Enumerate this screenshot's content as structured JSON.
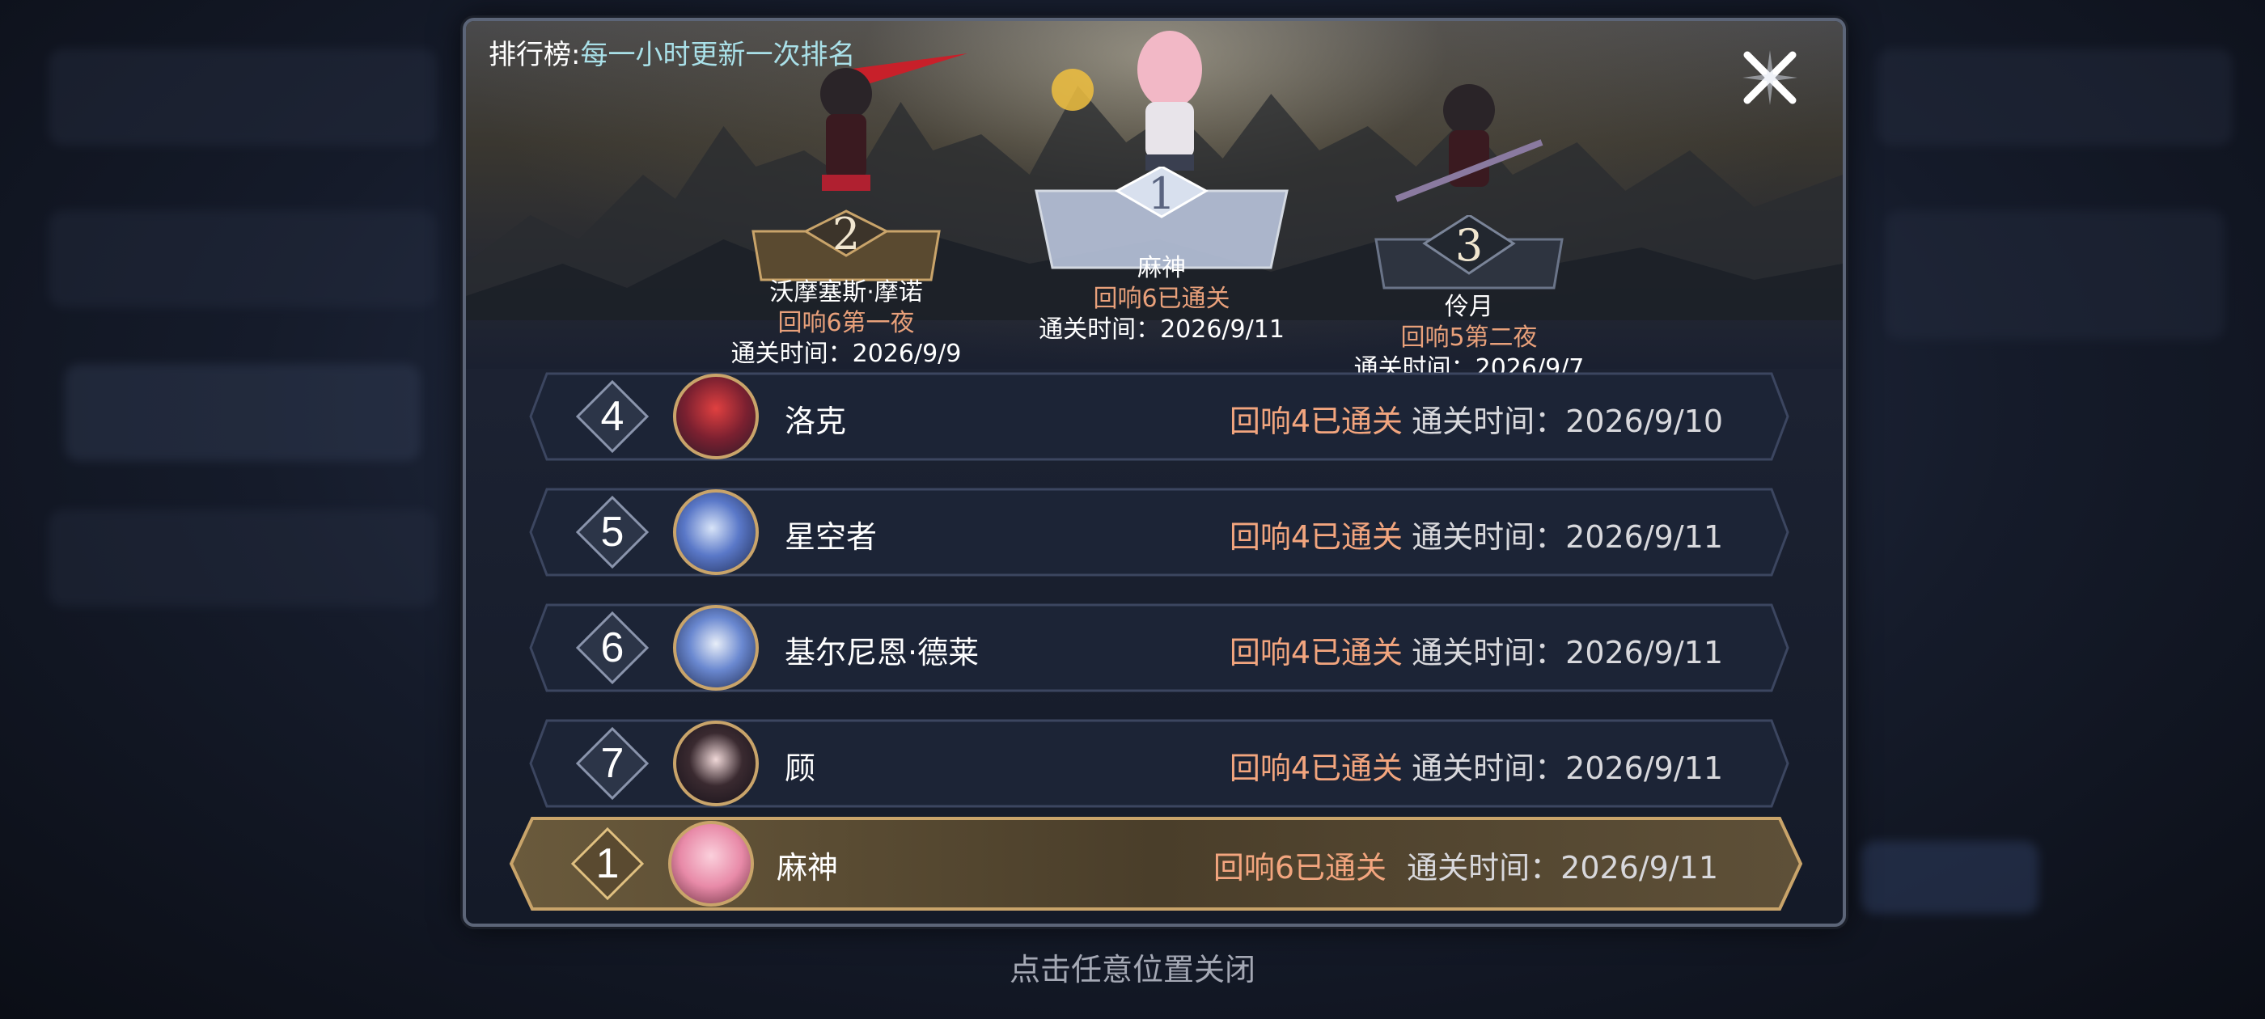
{
  "header": {
    "title": "排行榜:",
    "subtitle": "每一小时更新一次排名"
  },
  "podium": [
    {
      "rank": "2",
      "name": "沃摩塞斯·摩诺",
      "stage": "回响6第一夜",
      "time": "通关时间：2026/9/9"
    },
    {
      "rank": "1",
      "name": "麻神",
      "stage": "回响6已通关",
      "time": "通关时间：2026/9/11"
    },
    {
      "rank": "3",
      "name": "伶月",
      "stage": "回响5第二夜",
      "time": "通关时间：2026/9/7"
    }
  ],
  "rows": [
    {
      "rank": "4",
      "name": "洛克",
      "status": "回响4已通关",
      "time": "通关时间：2026/9/10"
    },
    {
      "rank": "5",
      "name": "星空者",
      "status": "回响4已通关",
      "time": "通关时间：2026/9/11"
    },
    {
      "rank": "6",
      "name": "基尔尼恩·德莱",
      "status": "回响4已通关",
      "time": "通关时间：2026/9/11"
    },
    {
      "rank": "7",
      "name": "顾",
      "status": "回响4已通关",
      "time": "通关时间：2026/9/11"
    }
  ],
  "self_row": {
    "rank": "1",
    "name": "麻神",
    "status": "回响6已通关",
    "time": "通关时间：2026/9/11"
  },
  "footer": {
    "hint": "点击任意位置关闭"
  },
  "colors": {
    "stage_text": "#f2a57e",
    "subtitle_text": "#a9e0e8",
    "gold_border": "#c9a46a",
    "self_row_bg": "#5a4a30"
  },
  "icons": {
    "close": "close-x-icon",
    "rank_badge": "diamond-rank-icon"
  }
}
